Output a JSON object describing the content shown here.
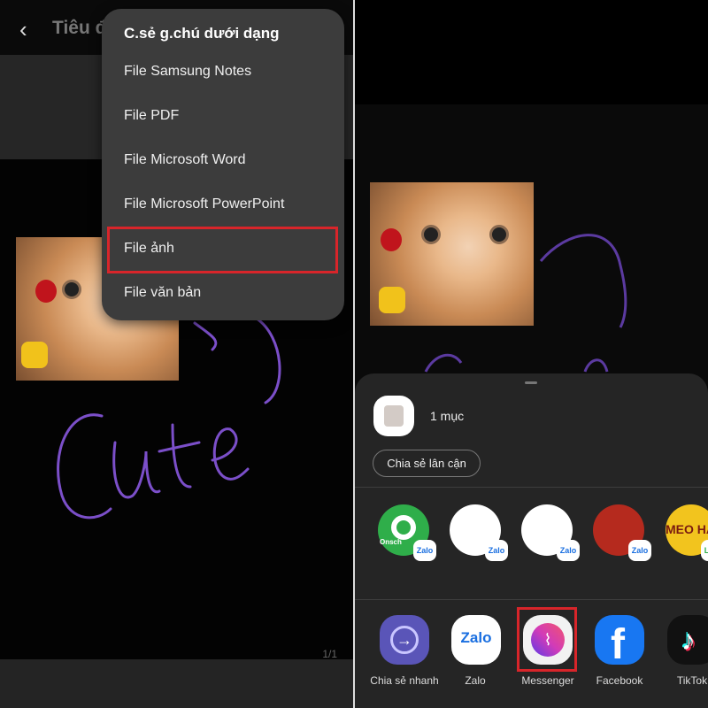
{
  "left": {
    "header": {
      "back_icon": "chevron-left-icon",
      "title": "Tiêu đ"
    },
    "page_indicator": "1/1",
    "share_menu": {
      "title": "C.sẻ g.chú dưới dạng",
      "items": [
        "File Samsung Notes",
        "File PDF",
        "File Microsoft Word",
        "File Microsoft PowerPoint",
        "File ảnh",
        "File văn bản"
      ],
      "highlighted": "File ảnh"
    },
    "drawing_color": "#7b4fc9"
  },
  "right": {
    "share_sheet": {
      "item_count": "1 mục",
      "nearby_share": "Chia sẻ lân cận",
      "contacts": [
        {
          "label": "Onsch",
          "badge": "Zalo",
          "color": "#2fae4a"
        },
        {
          "label": "",
          "badge": "Zalo",
          "color": "#ffffff"
        },
        {
          "label": "",
          "badge": "Zalo",
          "color": "#ffffff"
        },
        {
          "label": "",
          "badge": "Zalo",
          "color": "#b52a1e"
        },
        {
          "label": "MEO HA",
          "badge": "Line",
          "color": "#f2c41e"
        }
      ],
      "apps": [
        {
          "label": "Chia sẻ nhanh",
          "icon": "quick-share-icon",
          "color": "#5a55b8"
        },
        {
          "label": "Zalo",
          "icon": "zalo-icon",
          "color": "#ffffff"
        },
        {
          "label": "Messenger",
          "icon": "messenger-icon",
          "color": "#f2f2f2"
        },
        {
          "label": "Facebook",
          "icon": "facebook-icon",
          "color": "#1877f2"
        },
        {
          "label": "TikTok",
          "icon": "tiktok-icon",
          "color": "#111111"
        }
      ],
      "highlighted": "Messenger"
    }
  },
  "highlight_color": "#d8252a"
}
